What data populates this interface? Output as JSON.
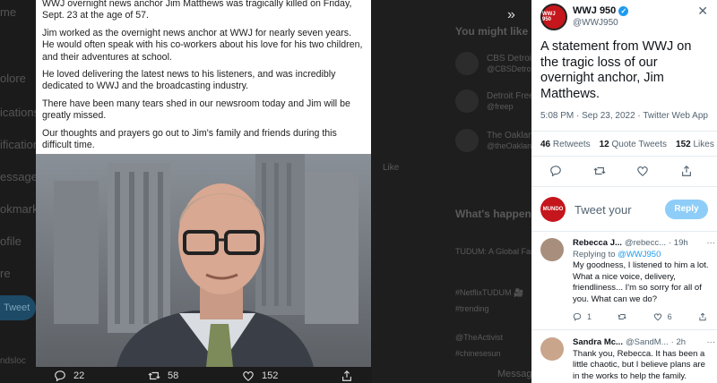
{
  "background": {
    "sidebar_items": [
      "me",
      "olore",
      "ications",
      "ifications",
      "essages",
      "okmarks",
      "ofile",
      "re",
      "Tweet",
      "ndsloc"
    ],
    "you_might_like": "You might like",
    "suggestions": [
      {
        "name": "CBS Detroit",
        "handle": "@CBSDetroit"
      },
      {
        "name": "Detroit Free ...",
        "handle": "@freep"
      },
      {
        "name": "The Oaklan...",
        "handle": "@theOaklan..."
      }
    ],
    "right_word": "Like",
    "whats_happening": "What's happening",
    "trend_lines": [
      "TUDUM: A Global Fan",
      "#NetflixTUDUM 🎥",
      "#trending",
      "@TheActivist",
      "#chinesesun",
      "Messages"
    ]
  },
  "post_image": {
    "paragraphs": [
      "WWJ overnight news anchor Jim Matthews was tragically killed on Friday, Sept. 23 at the age of 57.",
      "Jim worked as the overnight news anchor at WWJ for nearly seven years. He would often speak with his co-workers about his love for his two children, and their adventures at school.",
      "He loved delivering the latest news to his listeners, and was incredibly dedicated to WWJ and the broadcasting industry.",
      "There have been many tears shed in our newsroom today and Jim will be greatly missed.",
      "Our thoughts and prayers go out to Jim's family and friends during this difficult time."
    ]
  },
  "media_bar": {
    "replies": "22",
    "retweets": "58",
    "likes": "152"
  },
  "tweet": {
    "account_name": "WWJ 950",
    "handle": "@WWJ950",
    "logo_text": "WWJ 950",
    "text": "A statement from WWJ on the tragic loss of our overnight anchor, Jim Matthews.",
    "meta": "5:08 PM · Sep 23, 2022 · Twitter Web App",
    "retweets_count": "46",
    "retweets_label": "Retweets",
    "quotes_count": "12",
    "quotes_label": "Quote Tweets",
    "likes_count": "152",
    "likes_label": "Likes"
  },
  "reply_composer": {
    "avatar_text": "MUNDO",
    "placeholder": "Tweet your",
    "button": "Reply"
  },
  "replies": [
    {
      "name": "Rebecca J...",
      "handle": "@rebecc...",
      "time": "· 19h",
      "replying_label": "Replying to",
      "replying_to": "@WWJ950",
      "text": "My goodness, I listened to him a lot. What a nice voice, delivery, friendliness... I'm so sorry for all of you. What can we do?",
      "reply_count": "1",
      "like_count": "6"
    },
    {
      "name": "Sandra Mc...",
      "handle": "@SandM...",
      "time": "· 2h",
      "text": "Thank you, Rebecca.  It has been a little chaotic, but I believe plans are in the works to help the family."
    }
  ],
  "colors": {
    "accent": "#1d9bf0",
    "brand_red": "#c4161c"
  }
}
